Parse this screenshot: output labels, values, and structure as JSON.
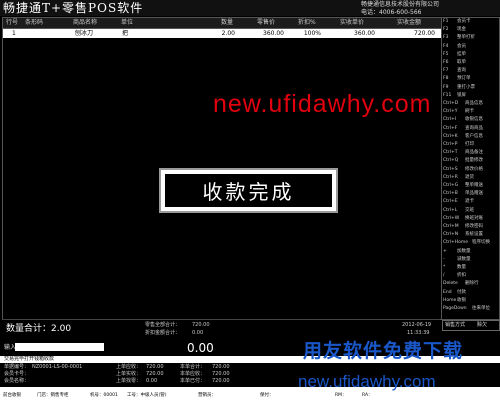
{
  "title_bar": {
    "app_title": "畅捷通T+零售POS软件",
    "company": "畅捷通信息技术股份有限公司",
    "phone": "电话：4006-600-566"
  },
  "table": {
    "columns": [
      "行号",
      "条形码",
      "商品名称",
      "单位",
      "数量",
      "零售价",
      "折扣%",
      "实收单价",
      "实收金额"
    ],
    "rows": [
      [
        "1",
        "",
        "刨冰刀",
        "把",
        "2.00",
        "360.00",
        "100%",
        "360.00",
        "720.00"
      ]
    ]
  },
  "overlay": {
    "message": "收款完成"
  },
  "watermarks": {
    "top": "new.ufidawhy.com",
    "bottom_cn": "用友软件免费下载",
    "bottom_url": "new.ufidawhy.com"
  },
  "sidebar": {
    "items": [
      {
        "key": "F1",
        "label": "会员卡"
      },
      {
        "key": "F2",
        "label": "现金"
      },
      {
        "key": "F3",
        "label": "整单打折"
      },
      {
        "key": "F4",
        "label": "会员"
      },
      {
        "key": "F5",
        "label": "挂单"
      },
      {
        "key": "F6",
        "label": "取单"
      },
      {
        "key": "F7",
        "label": "查询"
      },
      {
        "key": "F8",
        "label": "预订单"
      },
      {
        "key": "F9",
        "label": "重打小票"
      },
      {
        "key": "F11",
        "label": "锁屏"
      },
      {
        "key": "Ctrl+D",
        "label": "商品信息"
      },
      {
        "key": "Ctrl+Y",
        "label": "刷卡"
      },
      {
        "key": "Ctrl+I",
        "label": "收银信息"
      },
      {
        "key": "Ctrl+F",
        "label": "查询商品"
      },
      {
        "key": "Ctrl+K",
        "label": "客户信息"
      },
      {
        "key": "Ctrl+P",
        "label": "打印"
      },
      {
        "key": "Ctrl+T",
        "label": "商品备注"
      },
      {
        "key": "Ctrl+Q",
        "label": "批量修改"
      },
      {
        "key": "Ctrl+S",
        "label": "修改价格"
      },
      {
        "key": "Ctrl+R",
        "label": "退货"
      },
      {
        "key": "Ctrl+G",
        "label": "整单赠送"
      },
      {
        "key": "Ctrl+B",
        "label": "单品赠送"
      },
      {
        "key": "Ctrl+E",
        "label": "退卡"
      },
      {
        "key": "Ctrl+L",
        "label": "交班"
      },
      {
        "key": "Ctrl+W",
        "label": "换班对账"
      },
      {
        "key": "Ctrl+M",
        "label": "修改密码"
      },
      {
        "key": "Ctrl+N",
        "label": "系统设置"
      },
      {
        "key": "Ctrl+Home",
        "label": "程序切换"
      },
      {
        "key": "+",
        "label": "加数量"
      },
      {
        "key": "-",
        "label": "减数量"
      },
      {
        "key": "*",
        "label": "数量"
      },
      {
        "key": "/",
        "label": "折扣"
      },
      {
        "key": "Delete",
        "label": "删除行"
      },
      {
        "key": "End",
        "label": "付款"
      },
      {
        "key": "Home",
        "label": "收银"
      },
      {
        "key": "PageDown",
        "label": "往来单位"
      }
    ]
  },
  "summary": {
    "quantity_label": "数量合计：",
    "quantity_value": "2.00",
    "retail_total_label": "零售全部合计：",
    "retail_total_value": "720.00",
    "discount_total_label": "折扣金额合计：",
    "discount_total_value": "0.00",
    "date": "2012-06-19",
    "time": "11:33:39",
    "mode_labels": [
      "销售方式",
      "赊欠"
    ]
  },
  "input_bar": {
    "label": "输入：",
    "amount": "0.00"
  },
  "bottom": {
    "hint": "交易完毕打开钱箱收款",
    "info": {
      "doc_no_label": "单据编号：",
      "doc_no": "NZ0001-LS-00-0001",
      "member_no_label": "会员卡号：",
      "member_no": "",
      "member_name_label": "会员名称：",
      "member_name": "",
      "last_due_label": "上单应收：",
      "last_due": "720.00",
      "last_paid_label": "上单实收：",
      "last_paid": "720.00",
      "last_change_label": "上单找零：",
      "last_change": "0.00",
      "this_total_label": "本单合计：",
      "this_total": "720.00",
      "this_due_label": "本单应收：",
      "this_due": "720.00",
      "this_paid_label": "本单已付：",
      "this_paid": "720.00"
    },
    "status_items": [
      "前台收银",
      "门店：销售专柜",
      "机号：00001",
      "工号：中级人员(管)",
      "营销员：",
      "保付：",
      "RM：",
      "RA："
    ]
  }
}
